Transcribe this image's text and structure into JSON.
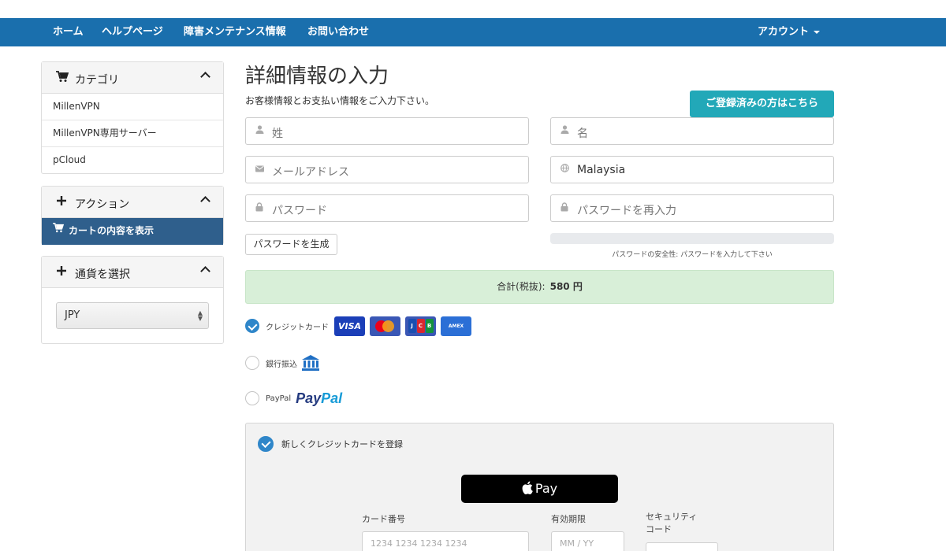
{
  "nav": {
    "items": [
      "ホーム",
      "ヘルプページ",
      "障害メンテナンス情報",
      "お問い合わせ"
    ],
    "account_label": "アカウント"
  },
  "sidebar": {
    "categories": {
      "title": "カテゴリ",
      "items": [
        "MillenVPN",
        "MillenVPN専用サーバー",
        "pCloud"
      ]
    },
    "actions": {
      "title": "アクション",
      "items": [
        "カートの内容を表示"
      ]
    },
    "currency": {
      "title": "通貨を選択",
      "selected": "JPY"
    }
  },
  "main": {
    "title": "詳細情報の入力",
    "subtitle": "お客様情報とお支払い情報をご入力下さい。",
    "login_button": "ご登録済みの方はこちら",
    "fields": {
      "last_name": "姓",
      "first_name": "名",
      "email": "メールアドレス",
      "country": "Malaysia",
      "password": "パスワード",
      "password_confirm": "パスワードを再入力"
    },
    "generate_password_button": "パスワードを生成",
    "password_strength_text": "パスワードの安全性: パスワードを入力して下さい",
    "password_strength_level": 0,
    "total": {
      "label": "合計(税抜):",
      "amount": "580 円"
    },
    "payment_methods": [
      {
        "label": "クレジットカード",
        "selected": true
      },
      {
        "label": "銀行振込",
        "selected": false
      },
      {
        "label": "PayPal",
        "selected": false
      }
    ],
    "card_logos": {
      "visa": "VISA",
      "jcb": [
        "J",
        "C",
        "B"
      ],
      "amex": "AMEX",
      "paypal_1": "Pay",
      "paypal_2": "Pal"
    },
    "card_panel": {
      "new_card_label": "新しくクレジットカードを登録",
      "apple_pay_label": "Pay",
      "card_number_label": "カード番号",
      "card_number_placeholder": "1234 1234 1234 1234",
      "expiry_label": "有効期限",
      "expiry_placeholder": "MM / YY",
      "cvc_label_1": "セキュリティ",
      "cvc_label_2": "コード"
    }
  },
  "colors": {
    "nav_bg": "#1a6fad",
    "accent_teal": "#22a8b8",
    "active_sidebar": "#2f5f8c",
    "total_bg": "#d8efd8",
    "radio_checked": "#2f86c9"
  },
  "icons": [
    "cart-icon",
    "plus-icon",
    "chevron-up-icon",
    "user-icon",
    "envelope-icon",
    "globe-icon",
    "lock-icon",
    "bank-icon",
    "apple-icon",
    "checkmark-icon",
    "updown-arrows-icon"
  ]
}
